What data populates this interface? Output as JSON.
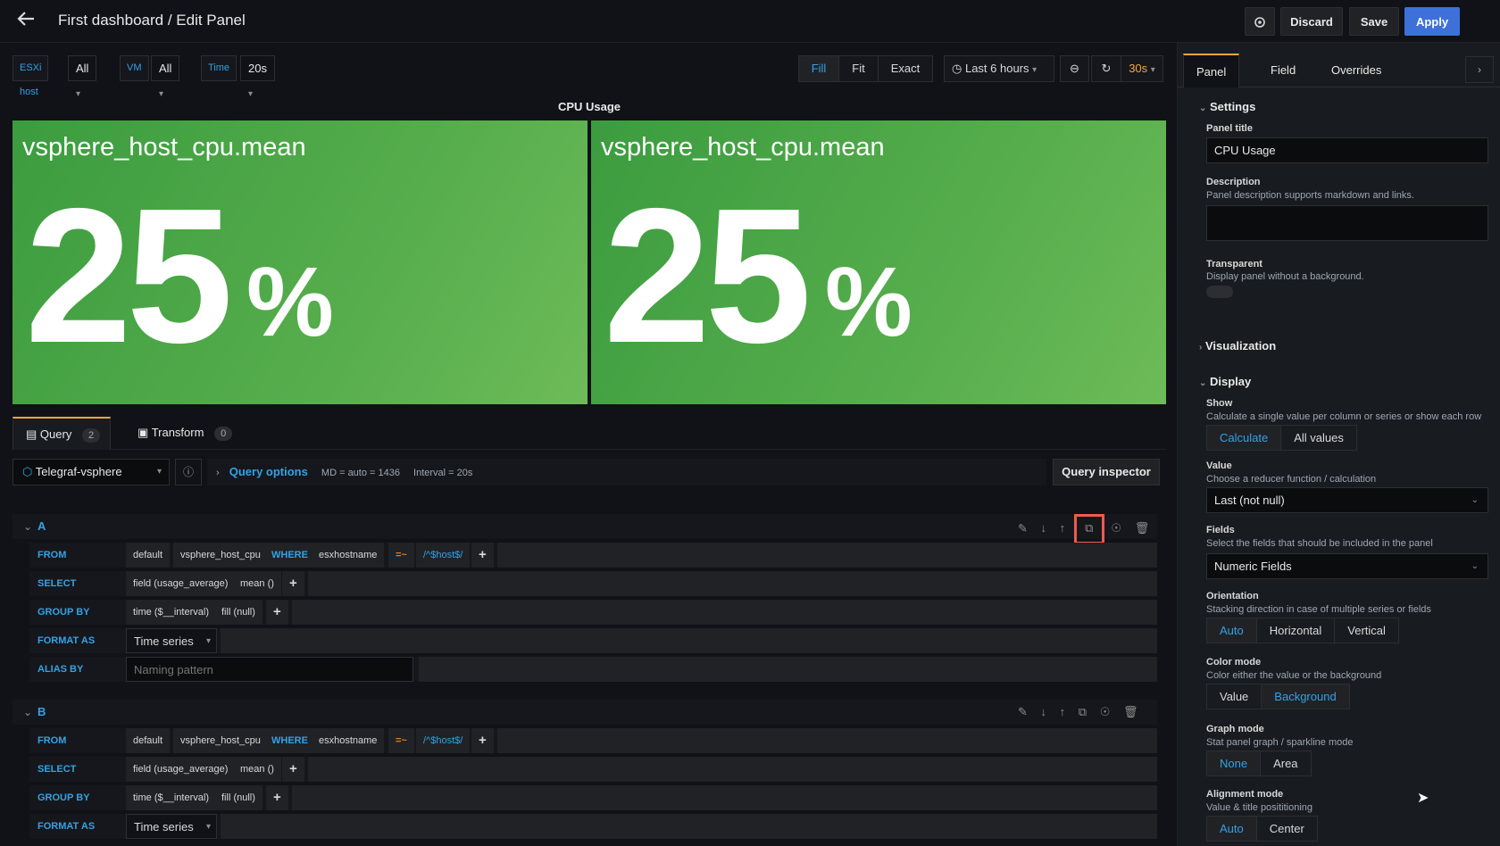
{
  "header": {
    "title": "First dashboard / Edit Panel",
    "discard": "Discard",
    "save": "Save",
    "apply": "Apply"
  },
  "variables": [
    {
      "label": "ESXi host",
      "value": "All"
    },
    {
      "label": "VM",
      "value": "All"
    },
    {
      "label": "Time",
      "value": "20s"
    }
  ],
  "view_modes": [
    "Fill",
    "Fit",
    "Exact"
  ],
  "time_range": "Last 6 hours",
  "refresh": "30s",
  "panel": {
    "title": "CPU Usage",
    "stats": [
      {
        "name": "vsphere_host_cpu.mean",
        "value": "25",
        "unit": "%"
      },
      {
        "name": "vsphere_host_cpu.mean",
        "value": "25",
        "unit": "%"
      }
    ]
  },
  "editor_tabs": {
    "query": {
      "label": "Query",
      "count": "2"
    },
    "transform": {
      "label": "Transform",
      "count": "0"
    }
  },
  "datasource": {
    "name": "Telegraf-vsphere",
    "query_options": "Query options",
    "md": "MD = auto = 1436",
    "interval": "Interval = 20s",
    "inspector": "Query inspector"
  },
  "queries": [
    {
      "id": "A",
      "from": [
        "default",
        "vsphere_host_cpu",
        "WHERE",
        "esxhostname",
        "=~",
        "/^$host$/"
      ],
      "select": [
        "field (usage_average)",
        "mean ()"
      ],
      "group_by": [
        "time ($__interval)",
        "fill (null)"
      ],
      "format_as": "Time series",
      "alias_placeholder": "Naming pattern"
    },
    {
      "id": "B",
      "from": [
        "default",
        "vsphere_host_cpu",
        "WHERE",
        "esxhostname",
        "=~",
        "/^$host$/"
      ],
      "select": [
        "field (usage_average)",
        "mean ()"
      ],
      "group_by": [
        "time ($__interval)",
        "fill (null)"
      ],
      "format_as": "Time series"
    }
  ],
  "query_labels": {
    "from": "FROM",
    "select": "SELECT",
    "group_by": "GROUP BY",
    "format_as": "FORMAT AS",
    "alias_by": "ALIAS BY"
  },
  "sidebar": {
    "tabs": [
      "Panel",
      "Field",
      "Overrides"
    ],
    "settings": "Settings",
    "panel_title_label": "Panel title",
    "panel_title_value": "CPU Usage",
    "description_label": "Description",
    "description_help": "Panel description supports markdown and links.",
    "transparent_label": "Transparent",
    "transparent_help": "Display panel without a background.",
    "visualization": "Visualization",
    "display": "Display",
    "show_label": "Show",
    "show_help": "Calculate a single value per column or series or show each row",
    "show_options": [
      "Calculate",
      "All values"
    ],
    "value_label": "Value",
    "value_help": "Choose a reducer function / calculation",
    "value_selected": "Last (not null)",
    "fields_label": "Fields",
    "fields_help": "Select the fields that should be included in the panel",
    "fields_selected": "Numeric Fields",
    "orientation_label": "Orientation",
    "orientation_help": "Stacking direction in case of multiple series or fields",
    "orientation_options": [
      "Auto",
      "Horizontal",
      "Vertical"
    ],
    "color_mode_label": "Color mode",
    "color_mode_help": "Color either the value or the background",
    "color_mode_options": [
      "Value",
      "Background"
    ],
    "graph_mode_label": "Graph mode",
    "graph_mode_help": "Stat panel graph / sparkline mode",
    "graph_mode_options": [
      "None",
      "Area"
    ],
    "alignment_label": "Alignment mode",
    "alignment_help": "Value & title posititioning",
    "alignment_options": [
      "Auto",
      "Center"
    ]
  },
  "colors": {
    "accent": "#33a2e5",
    "apply": "#3d71d9",
    "stat_green": "#56ad4c",
    "highlight": "#f05a4f",
    "refresh": "#f5a73c"
  }
}
